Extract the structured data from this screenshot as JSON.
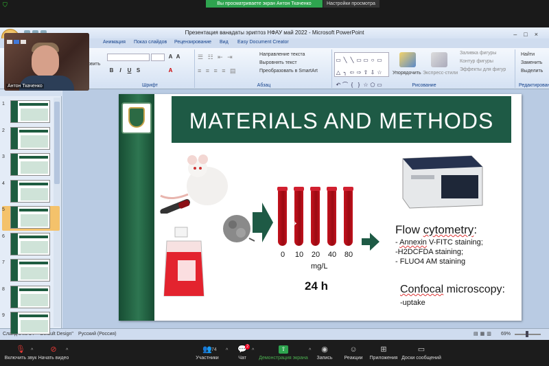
{
  "zoom_top": {
    "share_notice": "Вы просматриваете экран Антон Ткаченко",
    "view_options": "Настройки просмотра"
  },
  "window": {
    "title": "Презентация ванадаты эриптоз НФАУ май 2022 - Microsoft PowerPoint"
  },
  "ribbon": {
    "tabs": [
      "Анимация",
      "Показ слайдов",
      "Рецензирование",
      "Вид",
      "Easy Document Creator"
    ],
    "partial_left_label": "овить",
    "groups": {
      "font_label": "Шрифт",
      "paragraph_label": "Абзац",
      "drawing_label": "Рисование",
      "editing_label": "Редактирование"
    },
    "paragraph_cmds": [
      "Направление текста",
      "Выровнять текст",
      "Преобразовать в SmartArt"
    ],
    "arrange_label": "Упорядочить",
    "quick_styles_label": "Экспресс-стили",
    "shape_cmds": [
      "Заливка фигуры",
      "Контур фигуры",
      "Эффекты для фигур"
    ],
    "edit_cmds": [
      "Найти",
      "Заменить",
      "Выделить"
    ]
  },
  "self_view": {
    "name": "Антон Ткаченко"
  },
  "slides_panel": {
    "numbers": [
      "1",
      "2",
      "3",
      "4",
      "5",
      "6",
      "7",
      "8",
      "9"
    ],
    "active_index": 4
  },
  "slide": {
    "title": "MATERIALS AND METHODS",
    "concentrations": [
      "0",
      "10",
      "20",
      "40",
      "80"
    ],
    "unit": "mg/L",
    "time": "24 h",
    "flow_title": "Flow cytometry:",
    "flow_items": [
      "- Annexin V-FITC staining;",
      "-H2DCFDA staining;",
      "- FLUO4 AM staining"
    ],
    "confocal_title": "Confocal microscopy:",
    "confocal_item": "-uptake"
  },
  "status_bar": {
    "slide_info": "Слайд 5 из 14",
    "theme": "\"Default Design\"",
    "language": "Русский (Россия)",
    "zoom": "69%"
  },
  "zoom_bottom": {
    "mute": "Включить звук",
    "video": "Начать видео",
    "participants": "Участники",
    "participants_count": "74",
    "chat": "Чат",
    "chat_badge": "2",
    "share": "Демонстрация экрана",
    "record": "Запись",
    "reactions": "Реакции",
    "apps": "Приложения",
    "whiteboards": "Доски сообщений"
  },
  "colors": {
    "slide_green": "#1e5a45",
    "blood_red": "#b0101a",
    "zoom_green": "#2ea44f"
  }
}
